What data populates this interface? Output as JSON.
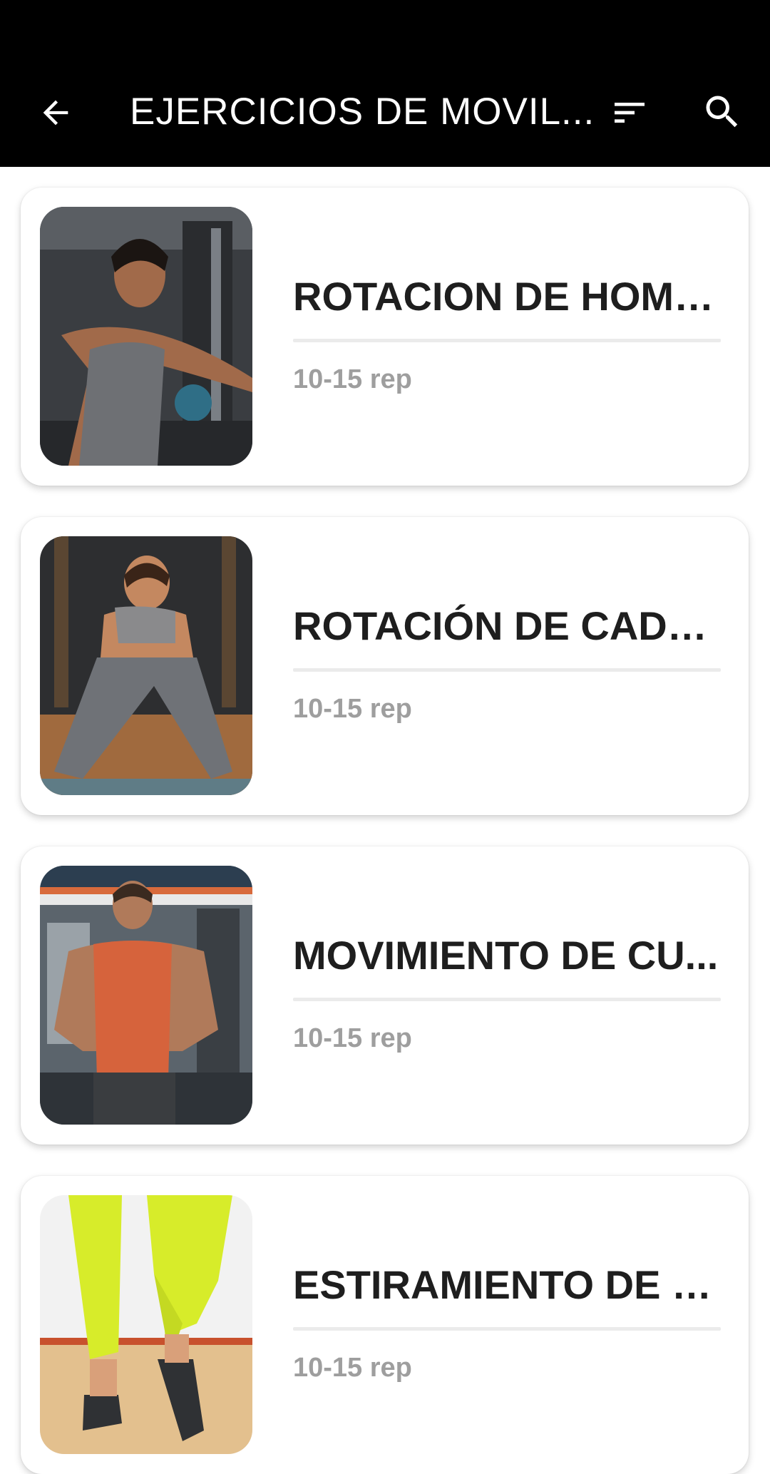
{
  "header": {
    "title": "EJERCICIOS DE MOVIL...",
    "back_icon": "arrow-left-icon",
    "sort_icon": "sort-icon",
    "search_icon": "search-icon"
  },
  "exercises": [
    {
      "name": "ROTACION DE HOMB...",
      "reps": "10-15 rep"
    },
    {
      "name": "ROTACIÓN DE CADE...",
      "reps": "10-15 rep"
    },
    {
      "name": "MOVIMIENTO DE CU...",
      "reps": "10-15 rep"
    },
    {
      "name": "ESTIRAMIENTO DE P...",
      "reps": "10-15 rep"
    }
  ]
}
